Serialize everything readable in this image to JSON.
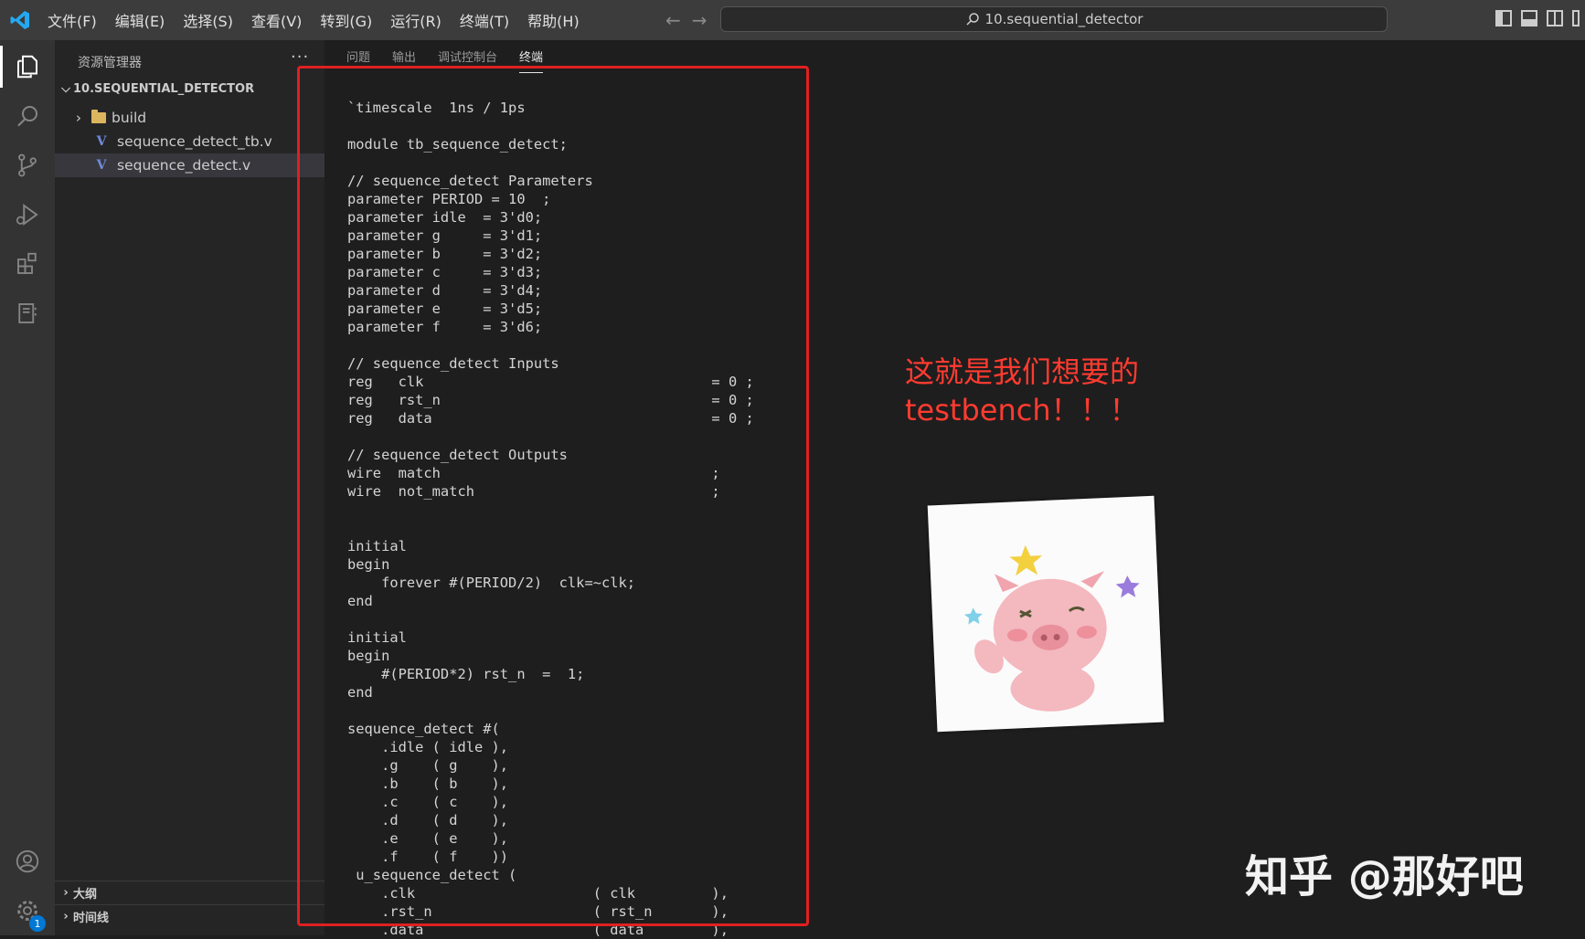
{
  "titlebar": {
    "menu": [
      "文件(F)",
      "编辑(E)",
      "选择(S)",
      "查看(V)",
      "转到(G)",
      "运行(R)",
      "终端(T)",
      "帮助(H)"
    ],
    "search": "10.sequential_detector"
  },
  "sidebar": {
    "title": "资源管理器",
    "more": "···",
    "folder": "10.SEQUENTIAL_DETECTOR",
    "items": [
      {
        "label": "build",
        "type": "folder"
      },
      {
        "label": "sequence_detect_tb.v",
        "type": "verilog"
      },
      {
        "label": "sequence_detect.v",
        "type": "verilog",
        "selected": true
      }
    ],
    "outline": "大纲",
    "timeline": "时间线"
  },
  "activity": {
    "badge": "1"
  },
  "panel": {
    "tabs": [
      "问题",
      "输出",
      "调试控制台",
      "终端"
    ],
    "active_tab": "终端"
  },
  "code": "`timescale  1ns / 1ps\n\nmodule tb_sequence_detect;\n\n// sequence_detect Parameters\nparameter PERIOD = 10  ;\nparameter idle  = 3'd0;\nparameter g     = 3'd1;\nparameter b     = 3'd2;\nparameter c     = 3'd3;\nparameter d     = 3'd4;\nparameter e     = 3'd5;\nparameter f     = 3'd6;\n\n// sequence_detect Inputs\nreg   clk                                  = 0 ;\nreg   rst_n                                = 0 ;\nreg   data                                 = 0 ;\n\n// sequence_detect Outputs\nwire  match                                ;\nwire  not_match                            ;\n\n\ninitial\nbegin\n    forever #(PERIOD/2)  clk=~clk;\nend\n\ninitial\nbegin\n    #(PERIOD*2) rst_n  =  1;\nend\n\nsequence_detect #(\n    .idle ( idle ),\n    .g    ( g    ),\n    .b    ( b    ),\n    .c    ( c    ),\n    .d    ( d    ),\n    .e    ( e    ),\n    .f    ( f    ))\n u_sequence_detect (\n    .clk                     ( clk         ),\n    .rst_n                   ( rst_n       ),\n    .data                    ( data        ),",
  "annotation": {
    "line1": "这就是我们想要的",
    "line2": "testbench！！！"
  },
  "watermark": "知乎 @那好吧",
  "colors": {
    "accent_red": "#ff3b30",
    "box_red": "#e02020",
    "activity_bar": "#333333",
    "sidebar": "#252526",
    "editor": "#1e1e1e"
  }
}
